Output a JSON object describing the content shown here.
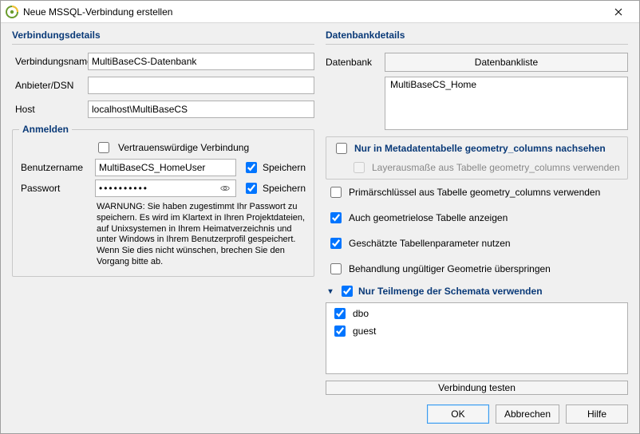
{
  "window": {
    "title": "Neue MSSQL-Verbindung erstellen"
  },
  "left": {
    "section_title": "Verbindungsdetails",
    "conn_name_label": "Verbindungsname",
    "conn_name_value": "MultiBaseCS-Datenbank",
    "provider_label": "Anbieter/DSN",
    "provider_value": "",
    "host_label": "Host",
    "host_value": "localhost\\MultiBaseCS",
    "login_group": "Anmelden",
    "trusted_label": "Vertrauenswürdige Verbindung",
    "user_label": "Benutzername",
    "user_value": "MultiBaseCS_HomeUser",
    "save_label": "Speichern",
    "pass_label": "Passwort",
    "pass_value": "••••••••••",
    "warn_text": "WARNUNG: Sie haben zugestimmt Ihr Passwort zu speichern.  Es wird im Klartext in Ihren Projektdateien, auf Unixsystemen in Ihrem Heimatverzeichnis und unter Windows in Ihrem Benutzerprofil gespeichert.  Wenn Sie dies nicht wünschen, brechen Sie den Vorgang bitte ab."
  },
  "right": {
    "section_title": "Datenbankdetails",
    "db_label": "Datenbank",
    "db_list_btn": "Datenbankliste",
    "db_items": [
      "MultiBaseCS_Home"
    ],
    "only_geom_label": "Nur in Metadatentabelle geometry_columns nachsehen",
    "layer_extent_label": "Layerausmaße aus Tabelle geometry_columns verwenden",
    "pk_geom_label": "Primärschlüssel aus Tabelle geometry_columns verwenden",
    "geomless_label": "Auch geometrielose Tabelle anzeigen",
    "estimate_label": "Geschätzte Tabellenparameter nutzen",
    "invalid_geom_label": "Behandlung ungültiger Geometrie überspringen",
    "subset_label": "Nur Teilmenge der Schemata verwenden",
    "schemas": [
      "dbo",
      "guest"
    ],
    "test_btn": "Verbindung testen"
  },
  "buttons": {
    "ok": "OK",
    "cancel": "Abbrechen",
    "help": "Hilfe"
  }
}
